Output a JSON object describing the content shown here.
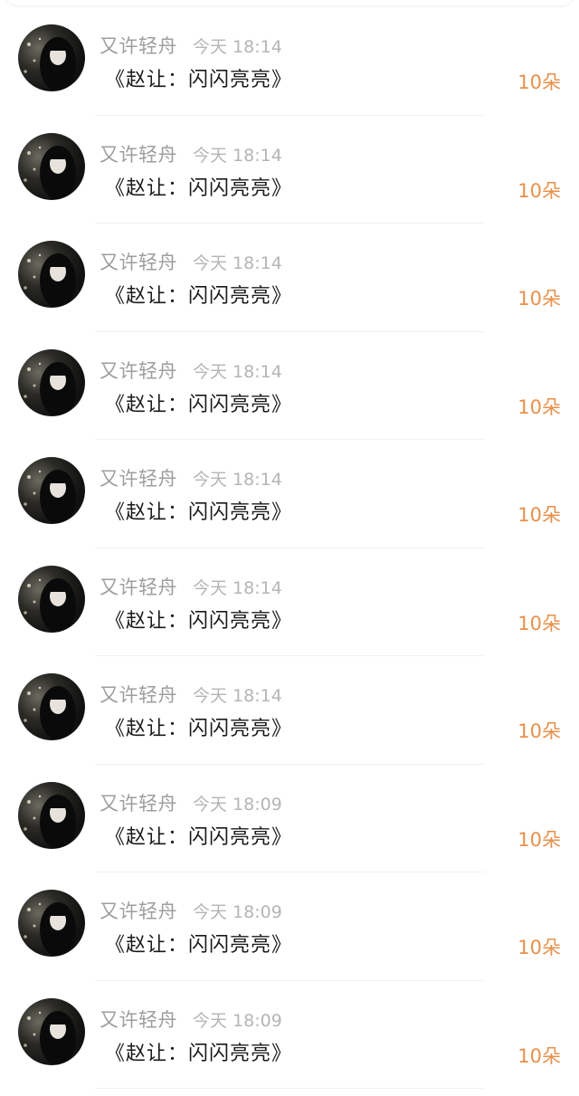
{
  "colors": {
    "name": "#9e9e9e",
    "time": "#b5b5b5",
    "gift": "#1a1a1a",
    "amount": "#e8904a"
  },
  "rows": [
    {
      "name": "又许轻舟",
      "time": "今天 18:14",
      "gift": "《赵让：闪闪亮亮》",
      "amount": "10朵"
    },
    {
      "name": "又许轻舟",
      "time": "今天 18:14",
      "gift": "《赵让：闪闪亮亮》",
      "amount": "10朵"
    },
    {
      "name": "又许轻舟",
      "time": "今天 18:14",
      "gift": "《赵让：闪闪亮亮》",
      "amount": "10朵"
    },
    {
      "name": "又许轻舟",
      "time": "今天 18:14",
      "gift": "《赵让：闪闪亮亮》",
      "amount": "10朵"
    },
    {
      "name": "又许轻舟",
      "time": "今天 18:14",
      "gift": "《赵让：闪闪亮亮》",
      "amount": "10朵"
    },
    {
      "name": "又许轻舟",
      "time": "今天 18:14",
      "gift": "《赵让：闪闪亮亮》",
      "amount": "10朵"
    },
    {
      "name": "又许轻舟",
      "time": "今天 18:14",
      "gift": "《赵让：闪闪亮亮》",
      "amount": "10朵"
    },
    {
      "name": "又许轻舟",
      "time": "今天 18:09",
      "gift": "《赵让：闪闪亮亮》",
      "amount": "10朵"
    },
    {
      "name": "又许轻舟",
      "time": "今天 18:09",
      "gift": "《赵让：闪闪亮亮》",
      "amount": "10朵"
    },
    {
      "name": "又许轻舟",
      "time": "今天 18:09",
      "gift": "《赵让：闪闪亮亮》",
      "amount": "10朵"
    }
  ]
}
